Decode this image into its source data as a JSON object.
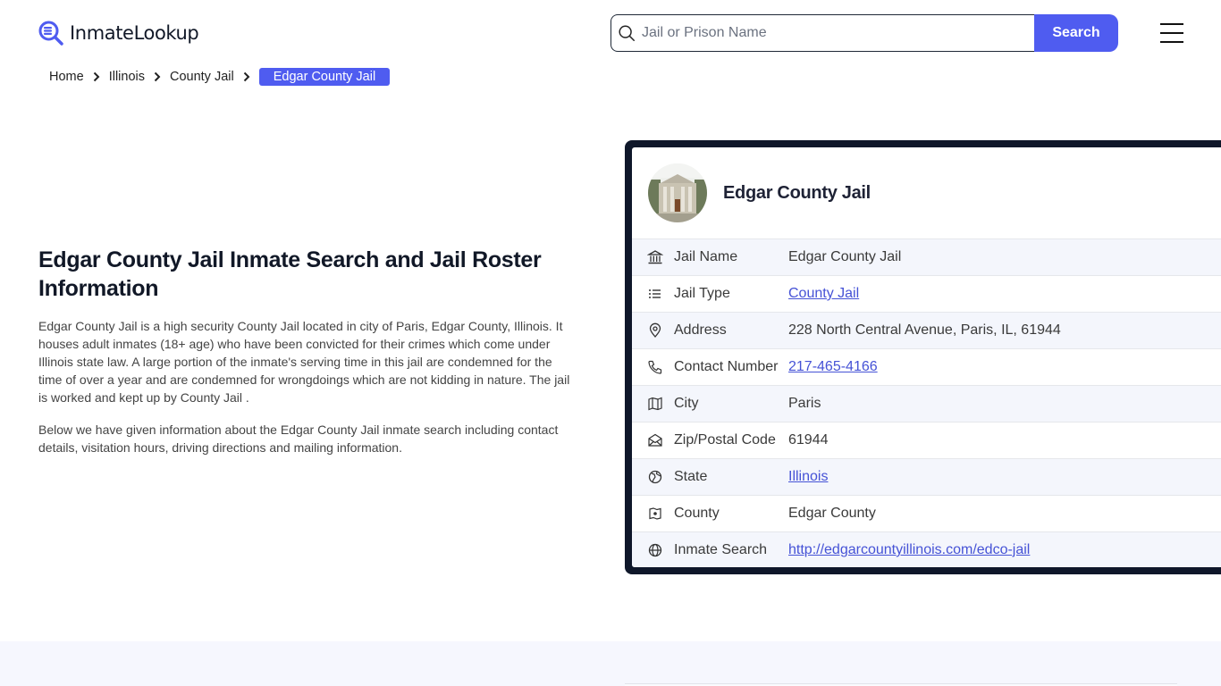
{
  "header": {
    "logo_text": "InmateLookup",
    "search_placeholder": "Jail or Prison Name",
    "search_value": "",
    "search_button": "Search",
    "accent_color": "#4f5cf0"
  },
  "breadcrumb": {
    "items": [
      "Home",
      "Illinois",
      "County Jail"
    ],
    "current": "Edgar County Jail"
  },
  "main": {
    "title": "Edgar County Jail Inmate Search and Jail Roster Information",
    "paragraphs": [
      "Edgar County Jail is a high security County Jail located in city of Paris, Edgar County, Illinois. It houses adult inmates (18+ age) who have been convicted for their crimes which come under Illinois state law. A large portion of the inmate's serving time in this jail are condemned for the time of over a year and are condemned for wrongdoings which are not kidding in nature. The jail is worked and kept up by County Jail .",
      "Below we have given information about the Edgar County Jail inmate search including contact details, visitation hours, driving directions and mailing information."
    ]
  },
  "card": {
    "title": "Edgar County Jail",
    "rows": [
      {
        "icon": "building-icon",
        "label": "Jail Name",
        "value": "Edgar County Jail",
        "link": false
      },
      {
        "icon": "list-icon",
        "label": "Jail Type",
        "value": "County Jail",
        "link": true
      },
      {
        "icon": "map-pin-icon",
        "label": "Address",
        "value": "228 North Central Avenue, Paris, IL, 61944",
        "link": false
      },
      {
        "icon": "phone-icon",
        "label": "Contact Number",
        "value": "217-465-4166",
        "link": true
      },
      {
        "icon": "map-icon",
        "label": "City",
        "value": "Paris",
        "link": false
      },
      {
        "icon": "mail-icon",
        "label": "Zip/Postal Code",
        "value": "61944",
        "link": false
      },
      {
        "icon": "globe-region-icon",
        "label": "State",
        "value": "Illinois",
        "link": true
      },
      {
        "icon": "county-map-icon",
        "label": "County",
        "value": "Edgar County",
        "link": false
      },
      {
        "icon": "globe-icon",
        "label": "Inmate Search",
        "value": "http://edgarcountyillinois.com/edco-jail",
        "link": true
      }
    ]
  }
}
